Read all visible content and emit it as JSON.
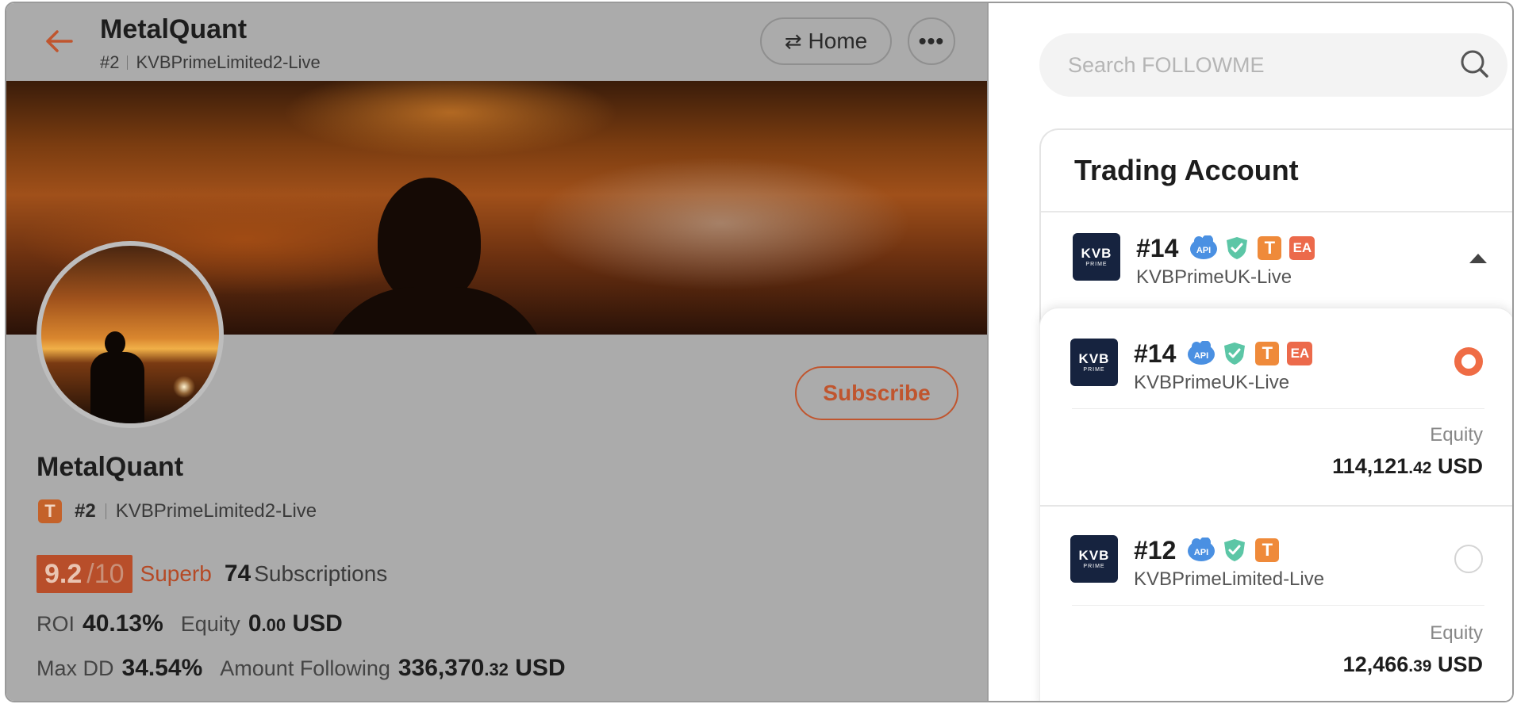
{
  "header": {
    "title": "MetalQuant",
    "rank": "#2",
    "broker_account": "KVBPrimeLimited2-Live",
    "home_label": "Home",
    "more_label": "•••"
  },
  "profile": {
    "name": "MetalQuant",
    "badge": "T",
    "rank": "#2",
    "broker_account": "KVBPrimeLimited2-Live",
    "subscribe_label": "Subscribe",
    "score": "9.2",
    "score_max": "/10",
    "score_label": "Superb",
    "subscriptions_count": "74",
    "subscriptions_label": "Subscriptions",
    "roi_label": "ROI",
    "roi_value": "40.13%",
    "equity_label": "Equity",
    "equity_int": "0",
    "equity_dec": ".00",
    "equity_unit": "USD",
    "maxdd_label": "Max DD",
    "maxdd_value": "34.54%",
    "following_label": "Amount Following",
    "following_int": "336,370",
    "following_dec": ".32",
    "following_unit": "USD"
  },
  "search": {
    "placeholder": "Search FOLLOWME"
  },
  "trading_account": {
    "title": "Trading Account",
    "selected": {
      "number": "#14",
      "server": "KVBPrimeUK-Live",
      "badges": [
        "API",
        "verified",
        "T",
        "EA"
      ]
    },
    "options": [
      {
        "number": "#14",
        "server": "KVBPrimeUK-Live",
        "badges": [
          "API",
          "verified",
          "T",
          "EA"
        ],
        "selected": true,
        "equity_label": "Equity",
        "equity_int": "114,121",
        "equity_dec": ".42",
        "equity_unit": "USD"
      },
      {
        "number": "#12",
        "server": "KVBPrimeLimited-Live",
        "badges": [
          "API",
          "verified",
          "T"
        ],
        "selected": false,
        "equity_label": "Equity",
        "equity_int": "12,466",
        "equity_dec": ".39",
        "equity_unit": "USD"
      }
    ]
  },
  "logo": {
    "line1": "KVB",
    "line2": "PRIME"
  },
  "badges": {
    "api": "API",
    "t": "T",
    "ea": "EA"
  },
  "colors": {
    "accent": "#c0552e",
    "radio_active": "#ef6c45",
    "overlay_gray": "#ababab",
    "kvb_navy": "#16233f",
    "api_blue": "#4a90e2",
    "verified_teal": "#5cc6a6",
    "t_orange": "#ef8a3a",
    "ea_red": "#ec6a4b"
  }
}
